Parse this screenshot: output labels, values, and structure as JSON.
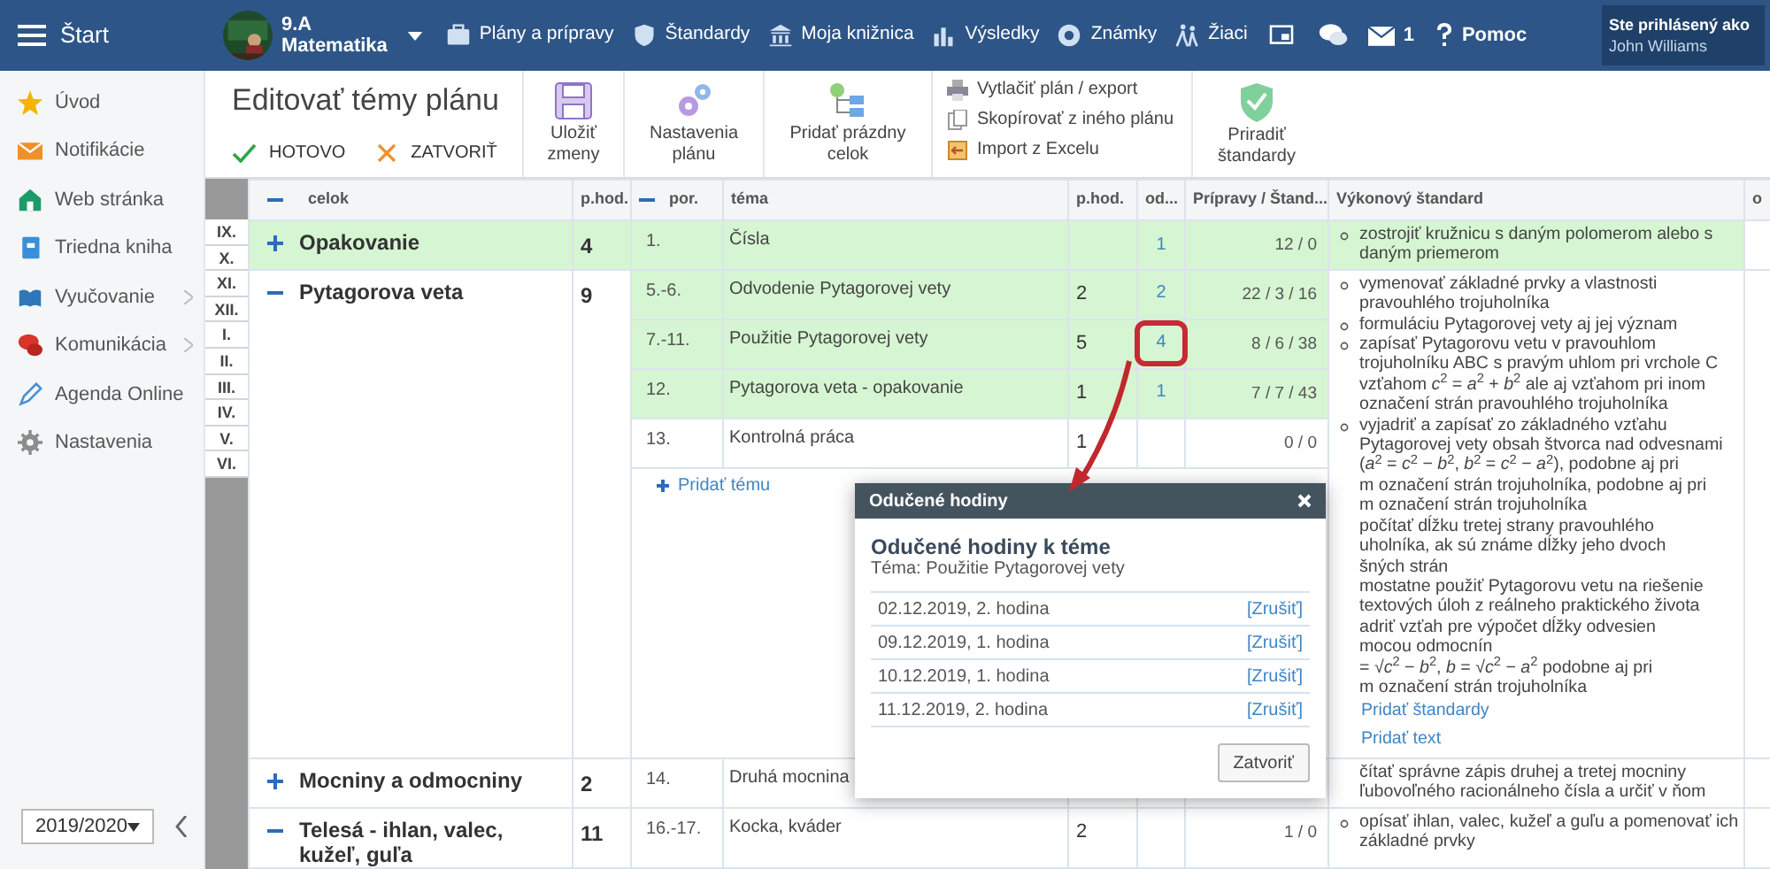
{
  "topbar": {
    "menu_label": "Štart",
    "class_name": "9.A",
    "subject": "Matematika",
    "nav": [
      "Plány a prípravy",
      "Štandardy",
      "Moja knižnica",
      "Výsledky",
      "Známky",
      "Žiaci"
    ],
    "mail_count": "1",
    "help_label": "Pomoc",
    "login_caption": "Ste prihlásený ako",
    "user": "John Williams"
  },
  "sidebar": {
    "items": [
      {
        "label": "Úvod",
        "submenu": false
      },
      {
        "label": "Notifikácie",
        "submenu": false
      },
      {
        "label": "Web stránka",
        "submenu": false
      },
      {
        "label": "Triedna kniha",
        "submenu": false
      },
      {
        "label": "Vyučovanie",
        "submenu": true
      },
      {
        "label": "Komunikácia",
        "submenu": true
      },
      {
        "label": "Agenda Online",
        "submenu": false
      },
      {
        "label": "Nastavenia",
        "submenu": false
      }
    ],
    "year": "2019/2020"
  },
  "toolbar": {
    "title": "Editovať témy plánu",
    "done": "HOTOVO",
    "close": "ZATVORIŤ",
    "buttons": [
      "Uložiť zmeny",
      "Nastavenia plánu",
      "Pridať prázdny celok"
    ],
    "actions": [
      "Vytlačiť plán / export",
      "Skopírovať z iného plánu",
      "Import z Excelu"
    ],
    "assign": "Priradiť štandardy"
  },
  "table": {
    "columns": [
      "celok",
      "p.hod.",
      "por.",
      "téma",
      "p.hod.",
      "od...",
      "Prípravy / Štand...",
      "Výkonový štandard",
      "o"
    ],
    "months": [
      "IX.",
      "X.",
      "XI.",
      "XII.",
      "I.",
      "II.",
      "III.",
      "IV.",
      "V.",
      "VI."
    ],
    "units": [
      {
        "name": "Opakovanie",
        "hours": "4",
        "expanded": false,
        "highlighted": true,
        "topics": [
          {
            "order": "1.",
            "name": "Čísla",
            "taught": "1",
            "prep": "12 / 0",
            "highlighted": true,
            "marked": false
          }
        ],
        "standards": [
          {
            "text": "zostrojiť kružnicu s daným polomerom alebo s daným priemerom",
            "bullet": true
          }
        ]
      },
      {
        "name": "Pytagorova veta",
        "hours": "9",
        "expanded": true,
        "highlighted": false,
        "topics": [
          {
            "order": "5.-6.",
            "name": "Odvodenie Pytagorovej vety",
            "hours": "2",
            "taught": "2",
            "prep": "22 / 3 / 16",
            "highlighted": true,
            "marked": false
          },
          {
            "order": "7.-11.",
            "name": "Použitie Pytagorovej vety",
            "hours": "5",
            "taught": "4",
            "prep": "8 / 6 / 38",
            "highlighted": true,
            "marked": true
          },
          {
            "order": "12.",
            "name": "Pytagorova veta - opakovanie",
            "hours": "1",
            "taught": "1",
            "prep": "7 / 7 / 43",
            "highlighted": true,
            "marked": false
          },
          {
            "order": "13.",
            "name": "Kontrolná práca",
            "hours": "1",
            "prep": "0 / 0",
            "highlighted": false,
            "marked": false
          }
        ],
        "add_topic": "Pridať tému",
        "standards": [
          {
            "text": "vymenovať základné prvky a vlastnosti pravouhlého trojuholníka",
            "bullet": true
          },
          {
            "text": "formuláciu Pytagorovej vety aj jej význam",
            "bullet": true
          },
          {
            "text": "zapísať Pytagorovu vetu v pravouhlom trojuholníku ABC s pravým uhlom pri vrchole C vzťahom *c*$^{2}$ = *a*$^{2}$ + *b*$^{2}$ ale aj vzťahom pri inom označení strán pravouhlého trojuholníka",
            "bullet": true
          },
          {
            "text": "vyjadriť a zapísať zo základného vzťahu Pytagorovej vety obsah štvorca nad odvesnami (*a*$^{2}$ = *c*$^{2}$ − *b*$^{2}$, *b*$^{2}$ = *c*$^{2}$ − *a*$^{2}$), podobne aj pri",
            "bullet": true
          },
          {
            "text": "m označení strán trojuholníka, podobne aj pri",
            "bullet": false
          },
          {
            "text": "m označení strán trojuholníka",
            "bullet": false
          },
          {
            "text": "počítať dĺžku tretej strany pravouhlého",
            "bullet": false
          },
          {
            "text": "uholníka, ak sú známe dĺžky jeho dvoch",
            "bullet": false
          },
          {
            "text": "šných strán",
            "bullet": false
          },
          {
            "text": "mostatne použiť Pytagorovu vetu na riešenie",
            "bullet": false
          },
          {
            "text": "textových úloh z reálneho praktického života",
            "bullet": false
          },
          {
            "text": "adriť vzťah pre výpočet dĺžky odvesien",
            "bullet": false
          },
          {
            "text": "mocou odmocnín",
            "bullet": false
          },
          {
            "text": "= √*c*$^{2}$ − *b*$^{2}$, *b* = √*c*$^{2}$ − *a*$^{2}$ podobne aj pri",
            "bullet": false
          },
          {
            "text": "m označení strán trojuholníka",
            "bullet": false
          }
        ],
        "links": [
          "Pridať štandardy",
          "Pridať text"
        ]
      },
      {
        "name": "Mocniny a odmocniny",
        "hours": "2",
        "expanded": false,
        "highlighted": false,
        "topics": [
          {
            "order": "14.",
            "name": "Druhá mocnina",
            "highlighted": false,
            "marked": false
          }
        ],
        "standards": [
          {
            "text": "čítať správne zápis druhej a tretej mocniny",
            "bullet": false
          },
          {
            "text": "ľubovoľného racionálneho čísla a určiť v ňom",
            "bullet": false
          }
        ]
      },
      {
        "name": "Telesá - ihlan, valec, kužeľ, guľa",
        "hours": "11",
        "expanded": true,
        "highlighted": false,
        "topics": [
          {
            "order": "16.-17.",
            "name": "Kocka, kváder",
            "hours": "2",
            "prep": "1 / 0",
            "highlighted": false,
            "marked": false
          }
        ],
        "standards": [
          {
            "text": "opísať ihlan, valec, kužeľ a guľu a pomenovať ich základné prvky",
            "bullet": true
          }
        ]
      }
    ]
  },
  "dialog": {
    "title": "Odučené hodiny",
    "heading": "Odučené hodiny k téme",
    "subtitle": "Téma: Použitie Pytagorovej vety",
    "rows": [
      {
        "date": "02.12.2019, 2. hodina",
        "action": "[Zrušiť]"
      },
      {
        "date": "09.12.2019, 1. hodina",
        "action": "[Zrušiť]"
      },
      {
        "date": "10.12.2019, 1. hodina",
        "action": "[Zrušiť]"
      },
      {
        "date": "11.12.2019, 2. hodina",
        "action": "[Zrušiť]"
      }
    ],
    "button": "Zatvoriť"
  }
}
